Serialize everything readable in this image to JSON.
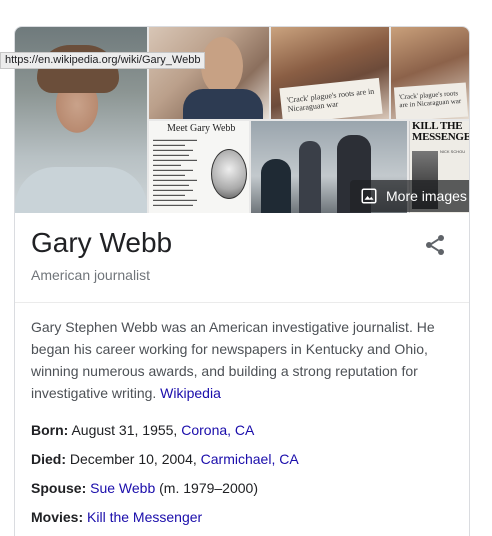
{
  "tooltip": {
    "url": "https://en.wikipedia.org/wiki/Gary_Webb"
  },
  "images": {
    "more_images_label": "More images",
    "newspaper_headline": "'Crack' plague's roots are in Nicaraguan war",
    "meet_heading": "Meet Gary Webb",
    "messenger_masthead": "KILL THE MESSENGER",
    "messenger_byline": "NICK SCHOU"
  },
  "entity": {
    "name": "Gary Webb",
    "type": "American journalist",
    "share_icon": "share-icon"
  },
  "description": {
    "text": "Gary Stephen Webb was an American investigative journalist. He began his career working for newspapers in Kentucky and Ohio, winning numerous awards, and building a strong reputation for investigative writing.",
    "source_link": "Wikipedia"
  },
  "facts": {
    "born": {
      "label": "Born:",
      "value": "August 31, 1955,",
      "link": "Corona, CA"
    },
    "died": {
      "label": "Died:",
      "value": "December 10, 2004,",
      "link": "Carmichael, CA"
    },
    "spouse": {
      "label": "Spouse:",
      "link": "Sue Webb",
      "value": "(m. 1979–2000)"
    },
    "movies": {
      "label": "Movies:",
      "link": "Kill the Messenger"
    }
  },
  "colors": {
    "link": "#1a0dab",
    "secondary_text": "#70757a",
    "body_text": "#4d5156",
    "border": "#dadce0"
  }
}
